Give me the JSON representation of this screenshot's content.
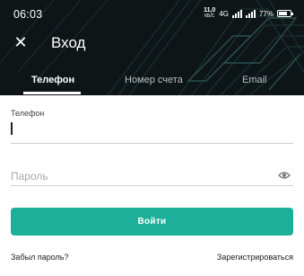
{
  "status_bar": {
    "time": "06:03",
    "net_speed_value": "11,0",
    "net_speed_unit": "КБ/С",
    "network_type": "4G",
    "battery_percent": "77%"
  },
  "header": {
    "title": "Вход",
    "close_icon": "close-icon",
    "background_color": "#0e1517",
    "accent_color": "#1cb09a"
  },
  "tabs": [
    {
      "label": "Телефон",
      "active": true
    },
    {
      "label": "Номер счета",
      "active": false
    },
    {
      "label": "Email",
      "active": false
    }
  ],
  "form": {
    "phone_label": "Телефон",
    "phone_value": "",
    "password_placeholder": "Пароль",
    "password_value": "",
    "eye_icon": "eye-icon",
    "submit_label": "Войти"
  },
  "footer": {
    "forgot_password": "Забыл пароль?",
    "register": "Зарегистрироваться"
  }
}
